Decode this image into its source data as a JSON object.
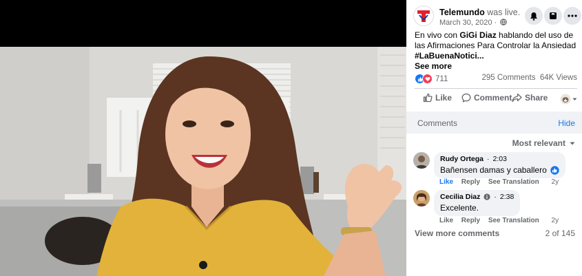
{
  "post": {
    "page_name": "Telemundo",
    "live_label": "was live.",
    "date": "March 30, 2020 ·",
    "text_prefix": "En vivo con ",
    "text_highlight": "GiGi Diaz",
    "text_body": " hablando del uso de las Afirmaciones Para Controlar la Ansiedad ",
    "hashtag": "#LaBuenaNotici...",
    "see_more": "See more"
  },
  "stats": {
    "reactions": "711",
    "comments": "295 Comments",
    "views": "64K Views"
  },
  "actions": {
    "like": "Like",
    "comment": "Comment",
    "share": "Share"
  },
  "comments_section": {
    "title": "Comments",
    "hide": "Hide",
    "sort": "Most relevant",
    "items": [
      {
        "name": "Rudy Ortega",
        "time": "2:03",
        "text": "Bañensen damas y caballero",
        "like": "Like",
        "reply": "Reply",
        "translate": "See Translation",
        "age": "2y"
      },
      {
        "name": "Cecilia Diaz",
        "time": "2:38",
        "text": "Excelente.",
        "like": "Like",
        "reply": "Reply",
        "translate": "See Translation",
        "age": "2y"
      }
    ],
    "view_more": "View more comments",
    "count": "2 of 145"
  },
  "colors": {
    "brand_blue": "#1877f2",
    "telemundo_red": "#e4202e",
    "love_red": "#f33e58",
    "dress_yellow": "#e2b23a"
  },
  "icons": [
    "telemundo-logo",
    "globe-icon",
    "bell-icon",
    "save-icon",
    "more-icon",
    "like-reaction-icon",
    "love-reaction-icon",
    "thumbs-up-icon",
    "comment-icon",
    "share-icon",
    "profile-avatar",
    "caret-down-icon",
    "info-icon"
  ]
}
